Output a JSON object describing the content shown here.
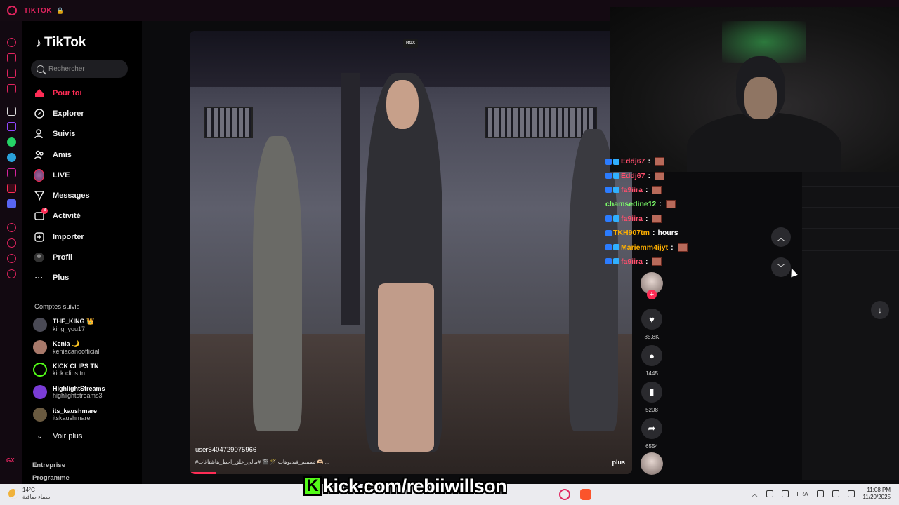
{
  "browser": {
    "title": "TIKTOK"
  },
  "nav": {
    "brand": "TikTok",
    "search_placeholder": "Rechercher",
    "items": [
      {
        "label": "Pour toi",
        "icon": "home-icon",
        "active": true
      },
      {
        "label": "Explorer",
        "icon": "compass-icon"
      },
      {
        "label": "Suivis",
        "icon": "following-icon"
      },
      {
        "label": "Amis",
        "icon": "friends-icon"
      },
      {
        "label": "LIVE",
        "icon": "live-avatar"
      },
      {
        "label": "Messages",
        "icon": "send-icon"
      },
      {
        "label": "Activité",
        "icon": "activity-icon",
        "badge": "8"
      },
      {
        "label": "Importer",
        "icon": "plus-icon"
      },
      {
        "label": "Profil",
        "icon": "profile-icon"
      },
      {
        "label": "Plus",
        "icon": "more-icon"
      }
    ],
    "following_title": "Comptes suivis",
    "accounts": [
      {
        "name": "THE_KING 👑",
        "handle": "king_you17"
      },
      {
        "name": "Kenia 🌙",
        "handle": "keniacanoofficial"
      },
      {
        "name": "KICK CLIPS TN",
        "handle": "kick.clips.tn"
      },
      {
        "name": "HighlightStreams",
        "handle": "highlightstreams3"
      },
      {
        "name": "its_kaushmare",
        "handle": "itskaushmare"
      }
    ],
    "see_more": "Voir plus",
    "footer": [
      "Entreprise",
      "Programme"
    ]
  },
  "video": {
    "watermark": "RGX",
    "username": "user5404729075966",
    "caption": "#تصميم_فيديوهات 🪄 🎬 #مالي_خلق_احط_هاشتاقات 🫶🏻 ...",
    "more": "plus",
    "progress": 0.06
  },
  "actions": {
    "likes": "85.8K",
    "comments": "1445",
    "saves": "5208",
    "shares": "6554"
  },
  "chat": [
    {
      "user": "Eddj67",
      "color": "#ff4f6d",
      "badges": 2,
      "text": "",
      "emote": true
    },
    {
      "user": "Eddj67",
      "color": "#ff4f6d",
      "badges": 2,
      "text": "",
      "emote": true
    },
    {
      "user": "fa9iira",
      "color": "#ff4f6d",
      "badges": 2,
      "text": "",
      "emote": true
    },
    {
      "user": "chamsedine12",
      "color": "#7cff6a",
      "badges": 0,
      "text": "",
      "emote": true
    },
    {
      "user": "fa9iira",
      "color": "#ff4f6d",
      "badges": 2,
      "text": "",
      "emote": true
    },
    {
      "user": "TKH907tm",
      "color": "#ffb000",
      "badges": 1,
      "text": "hours",
      "emote": false
    },
    {
      "user": "Mariemm4ijyt",
      "color": "#ffb000",
      "badges": 2,
      "text": "",
      "emote": true
    },
    {
      "user": "fa9iira",
      "color": "#ff4f6d",
      "badges": 2,
      "text": "",
      "emote": true
    }
  ],
  "taskbar": {
    "temp": "14°C",
    "condition": "سماء صافية",
    "lang": "FRA",
    "time": "11:08 PM",
    "date": "11/20/2025"
  },
  "overlay": {
    "kick_letter": "K",
    "url": "kick.com/rebiiwillson"
  }
}
